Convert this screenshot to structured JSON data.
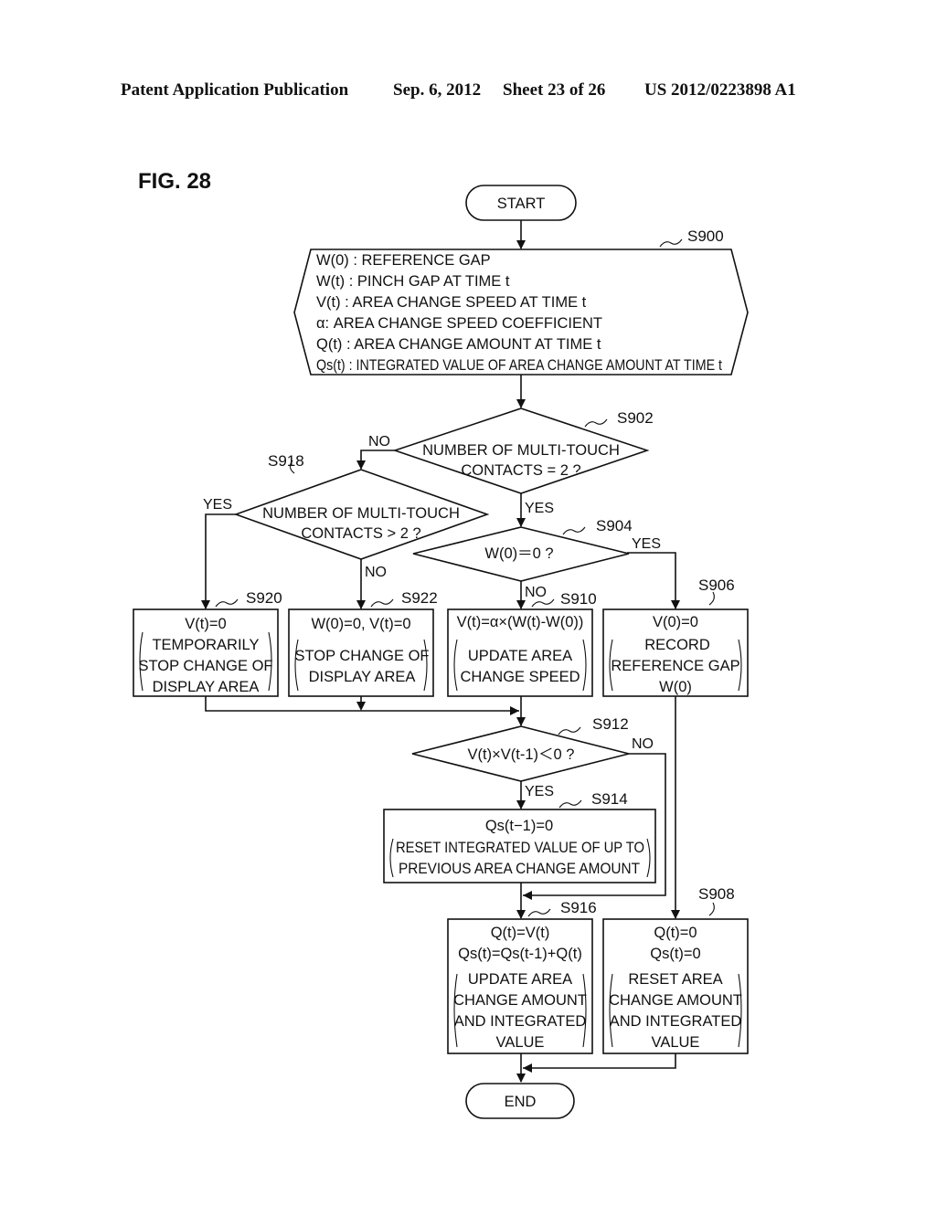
{
  "header": {
    "publication": "Patent Application Publication",
    "date": "Sep. 6, 2012",
    "sheet": "Sheet 23 of 26",
    "number": "US 2012/0223898 A1"
  },
  "figure": {
    "label": "FIG. 28"
  },
  "flowchart": {
    "start": "START",
    "end": "END",
    "s900": {
      "ref": "S900",
      "lines": [
        "W(0) : REFERENCE GAP",
        "W(t) : PINCH GAP AT TIME t",
        "V(t) : AREA CHANGE SPEED AT TIME t",
        "α:  AREA CHANGE SPEED COEFFICIENT",
        "Q(t) : AREA CHANGE AMOUNT AT TIME t",
        "Qs(t) :  INTEGRATED VALUE OF AREA CHANGE AMOUNT AT TIME t"
      ]
    },
    "s902": {
      "ref": "S902",
      "lines": [
        "NUMBER OF MULTI-TOUCH",
        "CONTACTS = 2 ?"
      ],
      "yes": "YES",
      "no": "NO"
    },
    "s918": {
      "ref": "S918",
      "lines": [
        "NUMBER OF MULTI-TOUCH",
        "CONTACTS > 2 ?"
      ],
      "yes": "YES",
      "no": "NO"
    },
    "s904": {
      "ref": "S904",
      "lines": [
        "W(0)＝0 ?"
      ],
      "yes": "YES",
      "no": "NO"
    },
    "s920": {
      "ref": "S920",
      "formula": [
        "V(t)=0"
      ],
      "description": [
        "TEMPORARILY",
        "STOP CHANGE OF",
        "DISPLAY AREA"
      ]
    },
    "s922": {
      "ref": "S922",
      "formula": [
        "W(0)=0, V(t)=0"
      ],
      "description": [
        "STOP CHANGE OF",
        "DISPLAY AREA"
      ]
    },
    "s910": {
      "ref": "S910",
      "formula": [
        "V(t)=α×(W(t)-W(0))"
      ],
      "description": [
        "UPDATE AREA",
        "CHANGE SPEED"
      ]
    },
    "s906": {
      "ref": "S906",
      "formula": [
        "V(0)=0"
      ],
      "description": [
        "RECORD",
        "REFERENCE GAP",
        "W(0)"
      ]
    },
    "s912": {
      "ref": "S912",
      "lines": [
        "V(t)×V(t-1)＜0 ?"
      ],
      "yes": "YES",
      "no": "NO"
    },
    "s914": {
      "ref": "S914",
      "formula": [
        "Qs(t−1)=0"
      ],
      "description": [
        "RESET INTEGRATED VALUE OF UP TO",
        "PREVIOUS AREA CHANGE AMOUNT"
      ]
    },
    "s916": {
      "ref": "S916",
      "formula": [
        "Q(t)=V(t)",
        "Qs(t)=Qs(t-1)+Q(t)"
      ],
      "description": [
        "UPDATE AREA",
        "CHANGE AMOUNT",
        "AND INTEGRATED",
        "VALUE"
      ]
    },
    "s908": {
      "ref": "S908",
      "formula": [
        "Q(t)=0",
        "Qs(t)=0"
      ],
      "description": [
        "RESET AREA",
        "CHANGE AMOUNT",
        "AND INTEGRATED",
        "VALUE"
      ]
    }
  }
}
